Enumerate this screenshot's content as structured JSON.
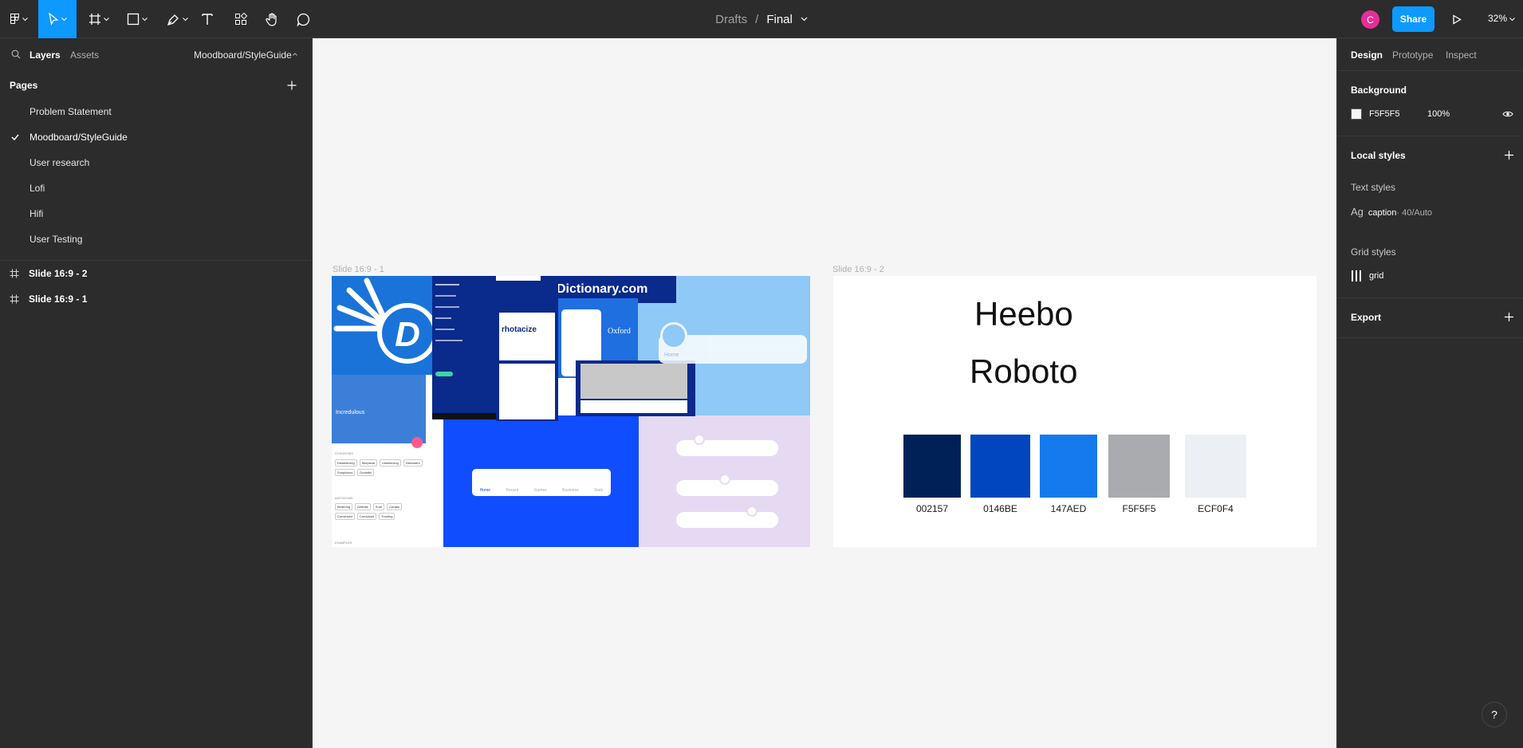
{
  "toolbar": {
    "tools": [
      "main-menu",
      "move",
      "frame",
      "rectangle",
      "pen",
      "text",
      "resources",
      "hand",
      "comment"
    ]
  },
  "breadcrumb": {
    "parent": "Drafts",
    "separator": "/",
    "current": "Final"
  },
  "user": {
    "avatar_letter": "C",
    "avatar_color": "#e62e98"
  },
  "share_label": "Share",
  "zoom": "32%",
  "left_panel": {
    "tabs": [
      "Layers",
      "Assets"
    ],
    "current_page_selector": "Moodboard/StyleGuide",
    "pages_heading": "Pages",
    "pages": [
      {
        "label": "Problem Statement",
        "selected": false
      },
      {
        "label": "Moodboard/StyleGuide",
        "selected": true
      },
      {
        "label": "User research",
        "selected": false
      },
      {
        "label": "Lofi",
        "selected": false
      },
      {
        "label": "Hifi",
        "selected": false
      },
      {
        "label": "User Testing",
        "selected": false
      }
    ],
    "layers": [
      "Slide 16:9 - 2",
      "Slide 16:9 - 1"
    ]
  },
  "canvas": {
    "frames": [
      {
        "label": "Slide 16:9 - 1"
      },
      {
        "label": "Slide 16:9 - 2"
      }
    ],
    "moodboard_texts": {
      "dictionary_brand": "Dictionary.com",
      "word": "Incredulous",
      "word_of_day": "rhotacize",
      "oxford": "Oxford",
      "home": "Home",
      "synonyms": "SYNONYMS",
      "antonyms": "ANTONYMS",
      "examples": "EXAMPLES",
      "synonym_chips": [
        "Disbelieving",
        "Skeptical",
        "Unbelieving",
        "Distrustful",
        "Suspicious",
        "Doubtful"
      ],
      "antonym_chips": [
        "Believing",
        "Definite",
        "Sure",
        "Certain",
        "Convinced",
        "Credulous",
        "Trusting"
      ],
      "nav_items": [
        "Home",
        "Recent",
        "Games",
        "Business",
        "Stats"
      ]
    },
    "style_guide": {
      "fonts": [
        "Heebo",
        "Roboto"
      ],
      "colors": [
        {
          "label": "002157",
          "hex": "#002157"
        },
        {
          "label": "0146BE",
          "hex": "#0146BE"
        },
        {
          "label": "147AED",
          "hex": "#147AED"
        },
        {
          "label": "F5F5F5",
          "hex": "#A9ABAF"
        },
        {
          "label": "ECF0F4",
          "hex": "#ECF0F4"
        }
      ]
    }
  },
  "right_panel": {
    "tabs": [
      "Design",
      "Prototype",
      "Inspect"
    ],
    "background_heading": "Background",
    "background_color": "F5F5F5",
    "background_opacity": "100%",
    "local_styles_heading": "Local styles",
    "text_styles_heading": "Text styles",
    "text_style": {
      "sample": "Ag",
      "name": "caption",
      "detail": " · 40/Auto"
    },
    "grid_styles_heading": "Grid styles",
    "grid_style_name": "grid",
    "export_heading": "Export"
  },
  "help_label": "?"
}
